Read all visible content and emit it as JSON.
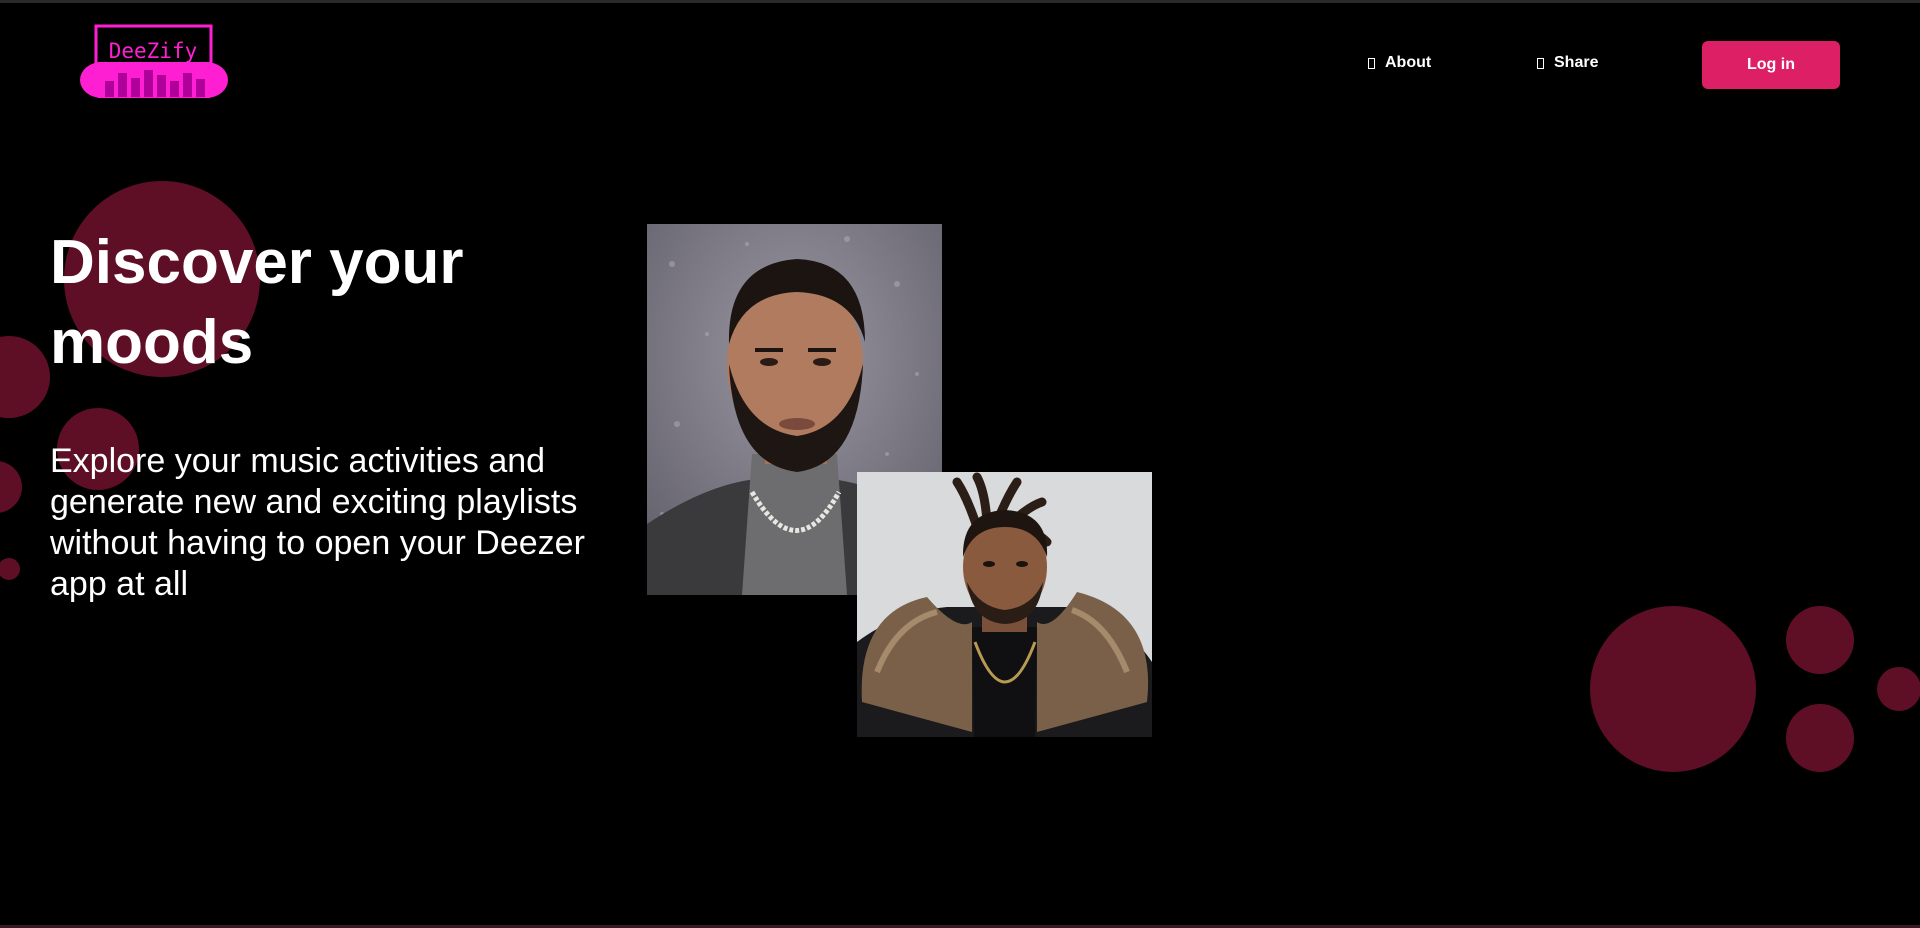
{
  "header": {
    "logo_text": "DeeZify",
    "nav": [
      {
        "label": "About",
        "icon": "about-icon"
      },
      {
        "label": "Share",
        "icon": "share-icon"
      }
    ],
    "login_label": "Log in"
  },
  "hero": {
    "title": "Discover your moods",
    "description": "Explore your music activities and generate new and exciting playlists without having to open your Deezer app at all"
  },
  "colors": {
    "background": "#000000",
    "accent": "#dd1f66",
    "logo_magenta": "#ff1fd2",
    "bubble": "#5e0f26"
  }
}
